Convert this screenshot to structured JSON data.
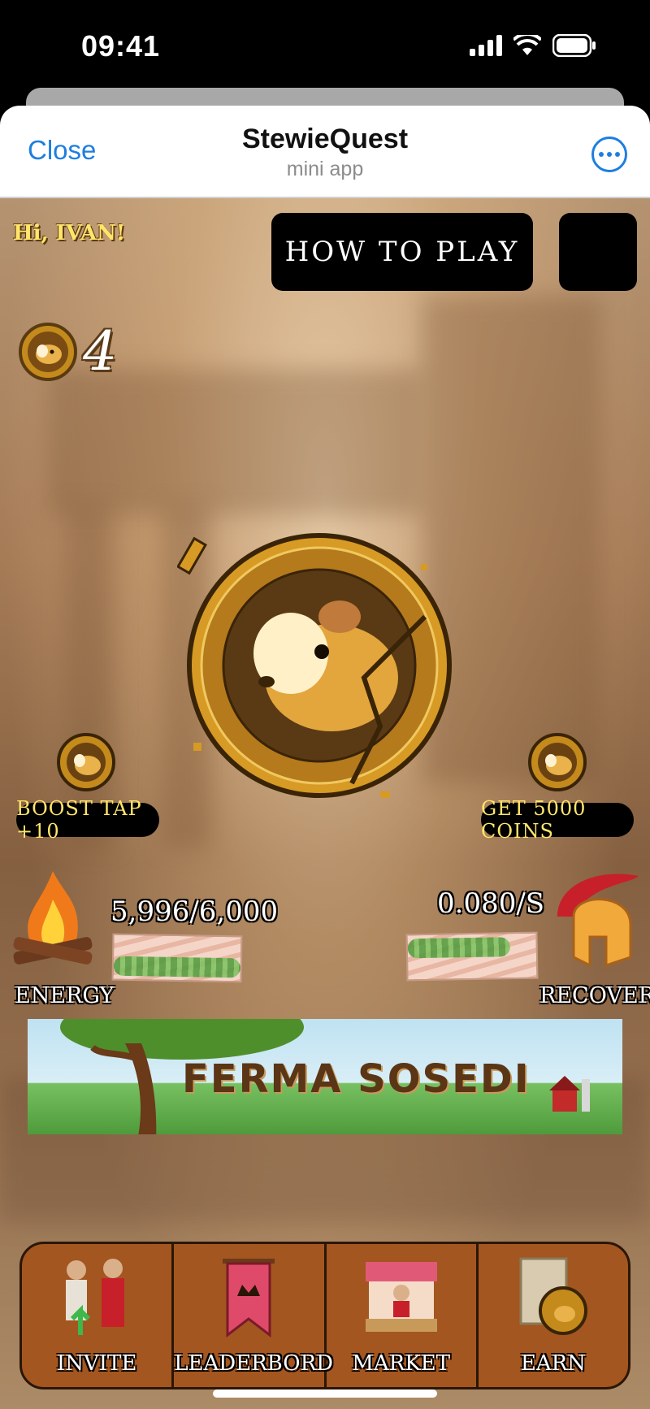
{
  "status_bar": {
    "time": "09:41"
  },
  "header": {
    "close_label": "Close",
    "title": "StewieQuest",
    "subtitle": "mini app"
  },
  "content": {
    "greeting": "Hi, IVAN!",
    "how_to_play": "HOW TO PLAY",
    "coin_count": "4",
    "boost_label": "BOOST TAP +10",
    "get_coins_label": "GET 5000 COINS",
    "energy_value": "5,996/6,000",
    "energy_label": "ENERGY",
    "energy_fill": 0.999,
    "rate_value": "0.080/S",
    "recovery_label": "RECOVERY",
    "banner_text": "FERMA SOSEDI"
  },
  "nav": {
    "items": [
      {
        "label": "INVITE",
        "icon": "invite-icon"
      },
      {
        "label": "LEADERBORD",
        "icon": "leaderboard-banner-icon"
      },
      {
        "label": "MARKET",
        "icon": "market-stall-icon"
      },
      {
        "label": "EARN",
        "icon": "earn-scroll-coin-icon"
      }
    ]
  },
  "colors": {
    "accent_blue": "#1e7ee0",
    "gold_text": "#ffe66a",
    "nav_brown": "#a3561f"
  }
}
